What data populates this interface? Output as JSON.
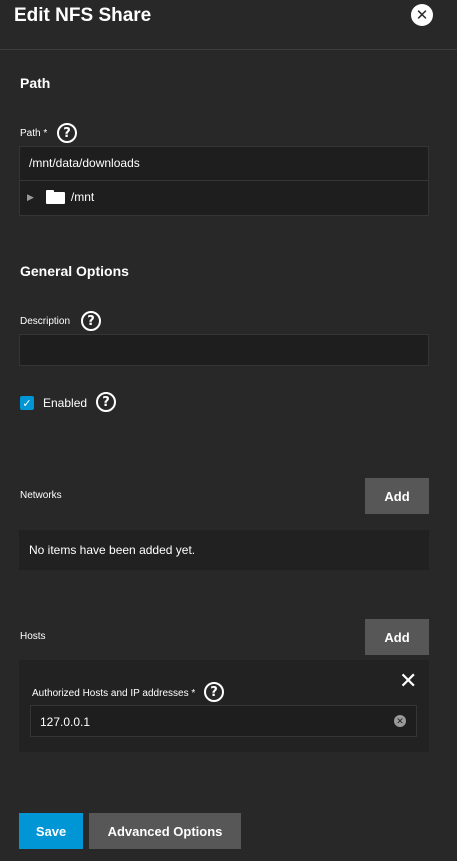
{
  "header": {
    "title": "Edit NFS Share",
    "close_icon": "close-circle-icon",
    "close_glyph": "✕"
  },
  "path_section": {
    "title": "Path",
    "path_label": "Path",
    "required_mark": "*",
    "path_value": "/mnt/data/downloads",
    "tree_arrow": "▶",
    "tree_root": "/mnt"
  },
  "general_section": {
    "title": "General Options",
    "description_label": "Description",
    "description_value": "",
    "enabled_label": "Enabled",
    "enabled_checked": true,
    "check_glyph": "✓"
  },
  "networks": {
    "label": "Networks",
    "add_label": "Add",
    "empty_text": "No items have been added yet."
  },
  "hosts": {
    "label": "Hosts",
    "add_label": "Add",
    "field_label": "Authorized Hosts and IP addresses",
    "required_mark": "*",
    "value": "127.0.0.1",
    "remove_glyph": "✕",
    "clear_glyph": "✕"
  },
  "help_glyph": "?",
  "footer": {
    "save_label": "Save",
    "advanced_label": "Advanced Options"
  },
  "colors": {
    "background": "#282828",
    "input_background": "#1e1e1e",
    "accent": "#0095d5",
    "button_gray": "#575757"
  }
}
